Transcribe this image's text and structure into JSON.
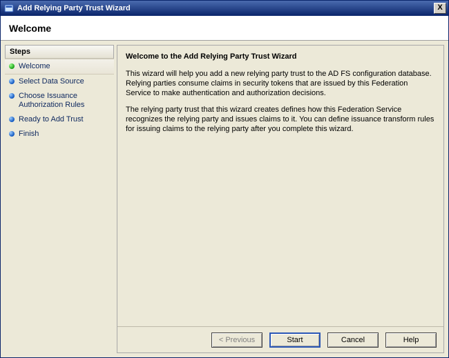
{
  "titlebar": {
    "title": "Add Relying Party Trust Wizard",
    "close_label": "X"
  },
  "banner": {
    "heading": "Welcome"
  },
  "steps": {
    "header": "Steps",
    "items": [
      {
        "label": "Welcome",
        "bullet": "green",
        "current": true
      },
      {
        "label": "Select Data Source",
        "bullet": "blue",
        "current": false
      },
      {
        "label": "Choose Issuance Authorization Rules",
        "bullet": "blue",
        "current": false
      },
      {
        "label": "Ready to Add Trust",
        "bullet": "blue",
        "current": false
      },
      {
        "label": "Finish",
        "bullet": "blue",
        "current": false
      }
    ]
  },
  "content": {
    "heading": "Welcome to the Add Relying Party Trust Wizard",
    "paragraph1": "This wizard will help you add a new relying party trust to the AD FS configuration database.  Relying parties consume claims in security tokens that are issued by this Federation Service to make authentication and authorization decisions.",
    "paragraph2": "The relying party trust that this wizard creates defines how this Federation Service recognizes the relying party and issues claims to it. You can define issuance transform rules for issuing claims to the relying party after you complete this wizard."
  },
  "buttons": {
    "previous": "< Previous",
    "start": "Start",
    "cancel": "Cancel",
    "help": "Help"
  },
  "colors": {
    "title_gradient_top": "#4a6baf",
    "title_gradient_bottom": "#0a246a",
    "canvas": "#ece9d8"
  }
}
